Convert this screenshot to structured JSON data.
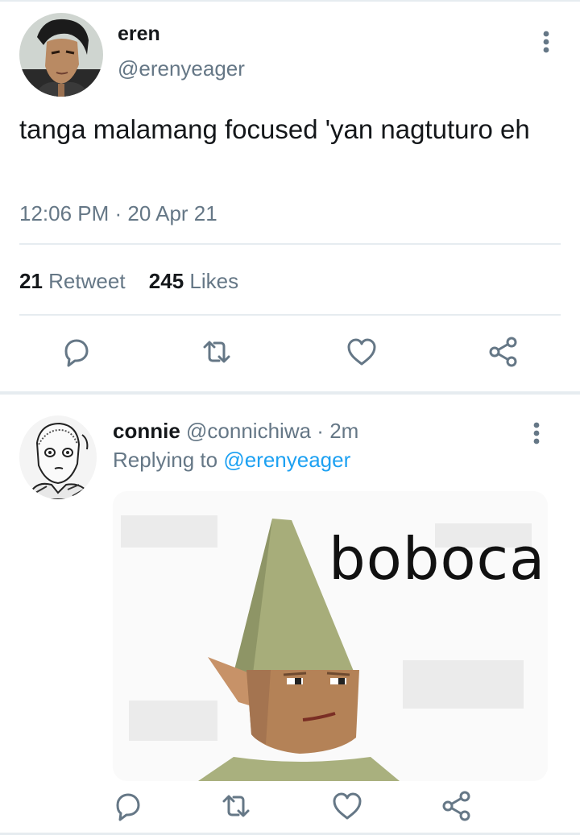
{
  "main_tweet": {
    "name": "eren",
    "handle": "@erenyeager",
    "text": "tanga malamang focused 'yan nagtuturo eh",
    "timestamp": "12:06 PM · 20 Apr 21",
    "retweet_count": "21",
    "retweet_label": "Retweet",
    "like_count": "245",
    "like_label": "Likes",
    "actions": [
      "reply-icon",
      "retweet-icon",
      "like-icon",
      "share-icon"
    ]
  },
  "reply_tweet": {
    "name": "connie",
    "handle": "@connichiwa",
    "separator": "·",
    "time_ago": "2m",
    "replying_label": "Replying to",
    "replying_to": "@erenyeager",
    "media_caption": "boboca",
    "actions": [
      "reply-icon",
      "retweet-icon",
      "like-icon",
      "share-icon"
    ]
  },
  "colors": {
    "text": "#14171a",
    "secondary": "#657786",
    "link": "#1da1f2",
    "divider": "#e6ecf0",
    "icon": "#657786"
  }
}
